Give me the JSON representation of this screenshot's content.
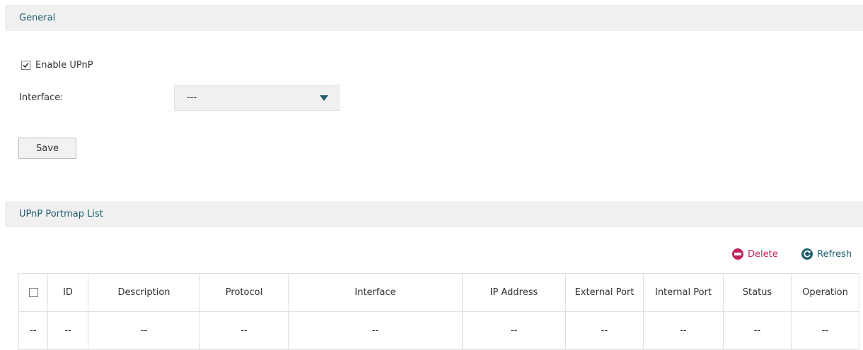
{
  "general": {
    "header": "General",
    "enable_upnp": {
      "label": "Enable UPnP",
      "checked": true
    },
    "interface": {
      "label": "Interface:",
      "value": "---"
    },
    "save_label": "Save"
  },
  "portmap": {
    "header": "UPnP Portmap List",
    "actions": {
      "delete": "Delete",
      "refresh": "Refresh"
    },
    "columns": [
      "ID",
      "Description",
      "Protocol",
      "Interface",
      "IP Address",
      "External Port",
      "Internal Port",
      "Status",
      "Operation"
    ],
    "rows": [
      [
        "--",
        "--",
        "--",
        "--",
        "--",
        "--",
        "--",
        "--",
        "--",
        "--"
      ]
    ]
  },
  "colors": {
    "accent": "#1f5f70",
    "delete": "#c0245f",
    "header_bg": "#f0f0f0"
  }
}
